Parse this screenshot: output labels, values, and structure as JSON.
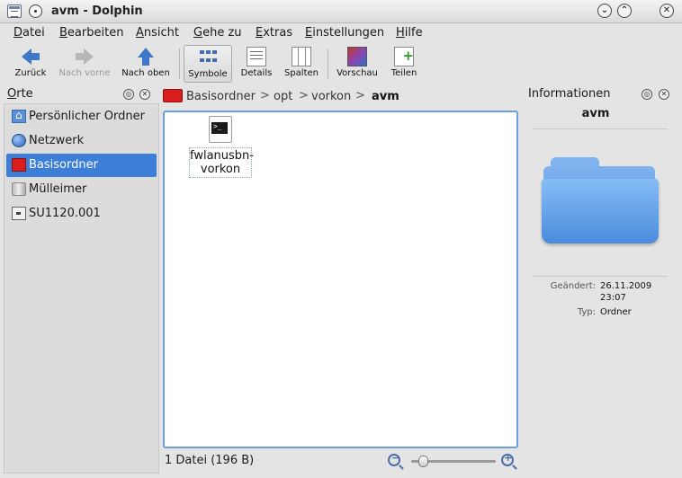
{
  "window": {
    "title": "avm - Dolphin",
    "buttons": {
      "minimize": "⌄",
      "maximize": "⌃",
      "close": "✕"
    }
  },
  "menubar": {
    "items": [
      {
        "first": "D",
        "rest": "atei"
      },
      {
        "first": "B",
        "rest": "earbeiten"
      },
      {
        "first": "A",
        "rest": "nsicht"
      },
      {
        "first": "G",
        "rest": "ehe zu"
      },
      {
        "first": "E",
        "rest": "xtras"
      },
      {
        "first": "E",
        "rest": "instellungen"
      },
      {
        "first": "H",
        "rest": "ilfe"
      }
    ]
  },
  "toolbar": {
    "back": "Zurück",
    "forward": "Nach vorne",
    "up": "Nach oben",
    "icons": "Symbole",
    "details": "Details",
    "columns": "Spalten",
    "preview": "Vorschau",
    "split": "Teilen"
  },
  "places": {
    "title_first": "O",
    "title_rest": "rte",
    "items": [
      {
        "label": "Persönlicher Ordner",
        "icon": "home-icon"
      },
      {
        "label": "Netzwerk",
        "icon": "globe-icon"
      },
      {
        "label": "Basisordner",
        "icon": "red-folder-icon"
      },
      {
        "label": "Mülleimer",
        "icon": "trash-icon"
      },
      {
        "label": "SU1120.001",
        "icon": "drive-icon"
      }
    ],
    "selected_index": 2
  },
  "breadcrumb": {
    "items": [
      "Basisordner",
      "opt",
      "vorkon"
    ],
    "current": "avm",
    "separator": ">"
  },
  "files": [
    {
      "name": "fwlanusbn-vorkon",
      "icon": "terminal-script-icon"
    }
  ],
  "statusbar": {
    "text": "1 Datei (196 B)",
    "zoom_level": 0.1
  },
  "info": {
    "title": "Informationen",
    "folder_name": "avm",
    "modified_label": "Geändert:",
    "modified_date": "26.11.2009",
    "modified_time": "23:07",
    "type_label": "Typ:",
    "type_value": "Ordner"
  },
  "colors": {
    "selection": "#3d7ed8",
    "focus_border": "#6ba0dc",
    "folder_blue": "#4a8bdc",
    "home_folder_red": "#d91c1c"
  }
}
